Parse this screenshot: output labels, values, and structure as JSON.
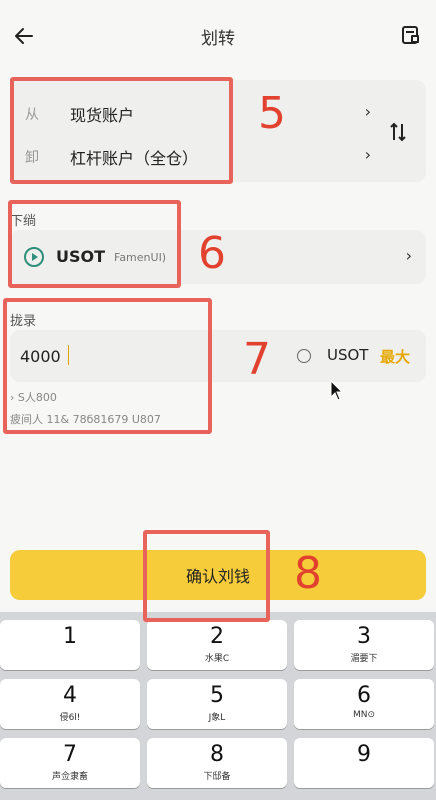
{
  "header": {
    "title": "划转",
    "back_icon": "arrow-left-icon",
    "record_icon": "record-icon"
  },
  "transfer": {
    "from_label": "从",
    "from_value": "现货账户",
    "to_label": "卸",
    "to_value": "杠杆账户（全仓）",
    "chevron": "›",
    "swap_icon": "swap-icon"
  },
  "coin": {
    "section_label": "下绱",
    "name": "USOT",
    "sub": "FamenUI)",
    "chevron": "›"
  },
  "amount": {
    "section_label": "拢录",
    "value": "4000",
    "unit": "USOT",
    "max_label": "最大",
    "hint1": "› S人800",
    "hint2": "疲间人 11& 78б81679 U807"
  },
  "confirm_label": "确认刘钱",
  "keypad": {
    "keys": [
      {
        "num": "1",
        "sub": ""
      },
      {
        "num": "2",
        "sub": "水果C"
      },
      {
        "num": "3",
        "sub": "湄要下"
      },
      {
        "num": "4",
        "sub": "侵6l!"
      },
      {
        "num": "5",
        "sub": "J象L"
      },
      {
        "num": "6",
        "sub": "MN⊙"
      },
      {
        "num": "7",
        "sub": "声佥隶畜"
      },
      {
        "num": "8",
        "sub": "下邸备"
      },
      {
        "num": "9",
        "sub": ""
      }
    ]
  },
  "annotations": [
    "5",
    "6",
    "7",
    "8"
  ],
  "colors": {
    "accent": "#f6cc3a",
    "max": "#e6a800",
    "annotation": "#e8645a",
    "coin_icon": "#2f8f7a"
  }
}
